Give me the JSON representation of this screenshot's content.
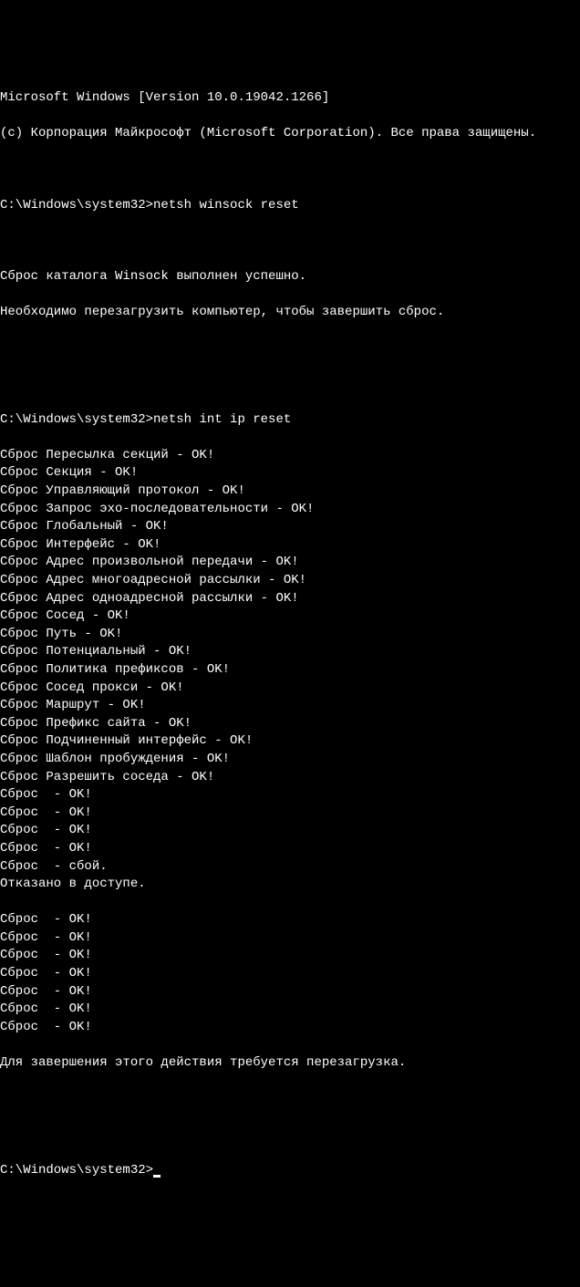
{
  "header": {
    "version_line": "Microsoft Windows [Version 10.0.19042.1266]",
    "copyright_line": "(c) Корпорация Майкрософт (Microsoft Corporation). Все права защищены."
  },
  "session": {
    "prompt1": "C:\\Windows\\system32>",
    "command1": "netsh winsock reset",
    "result1_line1": "Сброс каталога Winsock выполнен успешно.",
    "result1_line2": "Необходимо перезагрузить компьютер, чтобы завершить сброс.",
    "prompt2": "C:\\Windows\\system32>",
    "command2": "netsh int ip reset",
    "reset_lines": [
      "Сброс Пересылка секций - OK!",
      "Сброс Секция - OK!",
      "Сброс Управляющий протокол - OK!",
      "Сброс Запрос эхо-последовательности - OK!",
      "Сброс Глобальный - OK!",
      "Сброс Интерфейс - OK!",
      "Сброс Адрес произвольной передачи - OK!",
      "Сброс Адрес многоадресной рассылки - OK!",
      "Сброс Адрес одноадресной рассылки - OK!",
      "Сброс Сосед - OK!",
      "Сброс Путь - OK!",
      "Сброс Потенциальный - OK!",
      "Сброс Политика префиксов - OK!",
      "Сброс Сосед прокси - OK!",
      "Сброс Маршрут - OK!",
      "Сброс Префикс сайта - OK!",
      "Сброс Подчиненный интерфейс - OK!",
      "Сброс Шаблон пробуждения - OK!",
      "Сброс Разрешить соседа - OK!",
      "Сброс  - OK!",
      "Сброс  - OK!",
      "Сброс  - OK!",
      "Сброс  - OK!",
      "Сброс  - сбой.",
      "Отказано в доступе.",
      "",
      "Сброс  - OK!",
      "Сброс  - OK!",
      "Сброс  - OK!",
      "Сброс  - OK!",
      "Сброс  - OK!",
      "Сброс  - OK!",
      "Сброс  - OK!"
    ],
    "restart_message": "Для завершения этого действия требуется перезагрузка.",
    "prompt3": "C:\\Windows\\system32>"
  }
}
